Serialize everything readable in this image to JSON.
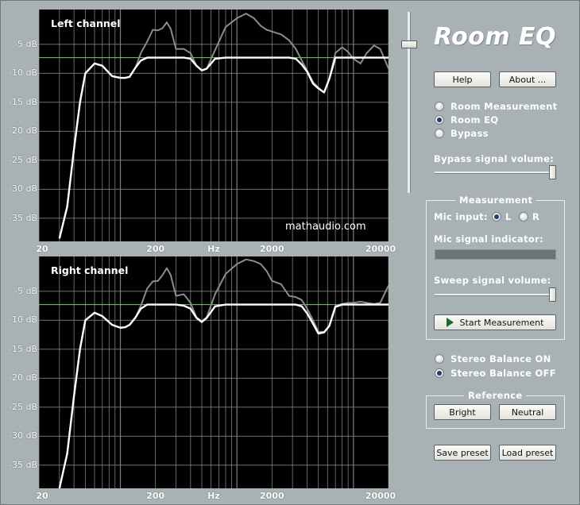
{
  "app": {
    "title": "Room EQ"
  },
  "buttons": {
    "help": "Help",
    "about": "About ...",
    "start_measurement": "Start Measurement",
    "bright": "Bright",
    "neutral": "Neutral",
    "save_preset": "Save preset",
    "load_preset": "Load preset"
  },
  "mode": {
    "options": [
      "Room Measurement",
      "Room EQ",
      "Bypass"
    ],
    "selected": "Room EQ"
  },
  "bypass_volume": {
    "label": "Bypass signal volume:",
    "level": 1.0
  },
  "master_slider": {
    "level": 0.82
  },
  "measurement": {
    "group_title": "Measurement",
    "mic_input_label": "Mic input:",
    "mic_options": [
      "L",
      "R"
    ],
    "mic_selected": "L",
    "mic_signal_label": "Mic signal indicator:",
    "sweep_label": "Sweep signal volume:",
    "sweep_level": 1.0
  },
  "stereo_balance": {
    "options": [
      "Stereo Balance ON",
      "Stereo Balance OFF"
    ],
    "selected": "Stereo Balance OFF"
  },
  "reference": {
    "group_title": "Reference"
  },
  "plots": {
    "watermark": "mathaudio.com",
    "db_ticks": [
      "-5 dB",
      "-10 dB",
      "-15 dB",
      "-20 dB",
      "-25 dB",
      "-30 dB",
      "-35 dB"
    ],
    "freq_ticks": [
      "20",
      "200",
      "Hz",
      "2000",
      "20000"
    ],
    "left_title": "Left channel",
    "right_title": "Right channel",
    "colors": {
      "background": "#000000",
      "grid": "#7f7f7f",
      "reference": "#6fd36f",
      "measured": "#8c8c8c",
      "equalized": "#ffffff"
    }
  },
  "chart_data": [
    {
      "type": "line",
      "title": "Left channel",
      "x_scale": "log",
      "xlim": [
        20,
        20000
      ],
      "ylim": [
        -39,
        1
      ],
      "xticks": [
        "20",
        "200",
        "2000",
        "20000"
      ],
      "yticks": [
        -5,
        -10,
        -15,
        -20,
        -25,
        -30,
        -35
      ],
      "reference_level": -7.3,
      "grid": true,
      "series": [
        {
          "x": [
            30,
            35,
            40,
            45,
            50,
            60,
            70,
            85,
            100,
            110,
            120,
            135,
            150,
            170,
            190,
            210,
            230,
            250,
            270,
            300,
            350,
            400,
            450,
            500,
            550,
            650,
            800,
            1000,
            1200,
            1400,
            1600,
            1800,
            2000,
            2400,
            2800,
            3200,
            3600,
            4000,
            4500,
            5000,
            5600,
            6200,
            7000,
            8000,
            9000,
            10000,
            11500,
            13000,
            15000,
            17000,
            20000
          ],
          "values": [
            -38.5,
            -33,
            -23,
            -15,
            -10,
            -8.3,
            -8.7,
            -10.5,
            -10.8,
            -10.8,
            -10.6,
            -9,
            -6.5,
            -4.5,
            -2.5,
            -2.6,
            -2.2,
            -1.2,
            -2.3,
            -5.8,
            -5.8,
            -6.5,
            -8.7,
            -9.5,
            -9.2,
            -6,
            -2,
            -0.5,
            0.3,
            -0.5,
            -1.8,
            -2.5,
            -2.8,
            -3.3,
            -4.3,
            -5.8,
            -7.8,
            -9.5,
            -11.5,
            -12.5,
            -13.3,
            -11,
            -6.5,
            -5.5,
            -6.3,
            -7.5,
            -8.3,
            -6.5,
            -5.2,
            -5.8,
            -9.2
          ]
        },
        {
          "x": [
            30,
            35,
            40,
            45,
            50,
            60,
            70,
            85,
            100,
            110,
            120,
            135,
            150,
            170,
            190,
            210,
            230,
            250,
            270,
            300,
            350,
            400,
            450,
            500,
            550,
            650,
            800,
            1000,
            1200,
            1400,
            1600,
            1800,
            2000,
            2400,
            2800,
            3200,
            3600,
            4000,
            4500,
            5000,
            5600,
            6200,
            7000,
            8000,
            9000,
            10000,
            11500,
            13000,
            15000,
            17000,
            20000
          ],
          "values": [
            -38.5,
            -33,
            -23,
            -15,
            -10,
            -8.3,
            -8.7,
            -10.5,
            -10.8,
            -10.8,
            -10.6,
            -9,
            -7.8,
            -7.3,
            -7.3,
            -7.3,
            -7.3,
            -7.3,
            -7.3,
            -7.3,
            -7.3,
            -7.5,
            -8.7,
            -9.5,
            -9.2,
            -7.5,
            -7.3,
            -7.3,
            -7.3,
            -7.3,
            -7.3,
            -7.3,
            -7.3,
            -7.3,
            -7.3,
            -7.5,
            -8.5,
            -9.7,
            -11.8,
            -12.6,
            -13.3,
            -11,
            -7.3,
            -7.3,
            -7.3,
            -7.3,
            -7.3,
            -7.3,
            -7.3,
            -7.3,
            -7.3
          ]
        }
      ]
    },
    {
      "type": "line",
      "title": "Right channel",
      "x_scale": "log",
      "xlim": [
        20,
        20000
      ],
      "ylim": [
        -39,
        1
      ],
      "xticks": [
        "20",
        "200",
        "2000",
        "20000"
      ],
      "yticks": [
        -5,
        -10,
        -15,
        -20,
        -25,
        -30,
        -35
      ],
      "reference_level": -7.3,
      "grid": true,
      "series": [
        {
          "x": [
            30,
            35,
            40,
            45,
            50,
            60,
            70,
            85,
            100,
            110,
            120,
            135,
            150,
            170,
            190,
            210,
            230,
            250,
            270,
            300,
            350,
            400,
            450,
            500,
            550,
            650,
            800,
            1000,
            1200,
            1400,
            1600,
            1800,
            2000,
            2400,
            2800,
            3200,
            3600,
            4000,
            4500,
            5000,
            5600,
            6200,
            7000,
            8000,
            9000,
            10000,
            11500,
            13000,
            15000,
            17000,
            20000
          ],
          "values": [
            -39,
            -33,
            -23,
            -15,
            -10,
            -8.7,
            -9.3,
            -10.8,
            -11.3,
            -11.2,
            -10.8,
            -9.5,
            -7.5,
            -4.5,
            -3.3,
            -3.2,
            -2.2,
            -1,
            -2.2,
            -5.8,
            -5.5,
            -7,
            -9.5,
            -10.2,
            -9.5,
            -5.5,
            -2,
            -0.3,
            0.5,
            0.2,
            -0.3,
            -1.5,
            -3.2,
            -3.8,
            -5.8,
            -6,
            -6.5,
            -8,
            -10,
            -12,
            -12,
            -11,
            -7.5,
            -7.2,
            -7,
            -7,
            -6.8,
            -7,
            -7.2,
            -7,
            -4
          ]
        },
        {
          "x": [
            30,
            35,
            40,
            45,
            50,
            60,
            70,
            85,
            100,
            110,
            120,
            135,
            150,
            170,
            190,
            210,
            230,
            250,
            270,
            300,
            350,
            400,
            450,
            500,
            550,
            650,
            800,
            1000,
            1200,
            1400,
            1600,
            1800,
            2000,
            2400,
            2800,
            3200,
            3600,
            4000,
            4500,
            5000,
            5600,
            6200,
            7000,
            8000,
            9000,
            10000,
            11500,
            13000,
            15000,
            17000,
            20000
          ],
          "values": [
            -39,
            -33,
            -23,
            -15,
            -10,
            -8.7,
            -9.3,
            -10.8,
            -11.3,
            -11.2,
            -10.8,
            -9.5,
            -8,
            -7.3,
            -7.3,
            -7.3,
            -7.3,
            -7.3,
            -7.3,
            -7.3,
            -7.5,
            -8,
            -9.6,
            -10.3,
            -9.6,
            -7.6,
            -7.3,
            -7.3,
            -7.3,
            -7.3,
            -7.3,
            -7.3,
            -7.3,
            -7.3,
            -7.3,
            -7.3,
            -7.6,
            -8.8,
            -10.6,
            -12.3,
            -12.1,
            -11,
            -7.7,
            -7.3,
            -7.3,
            -7.3,
            -7.3,
            -7.3,
            -7.3,
            -7.3,
            -7.3
          ]
        }
      ]
    }
  ]
}
